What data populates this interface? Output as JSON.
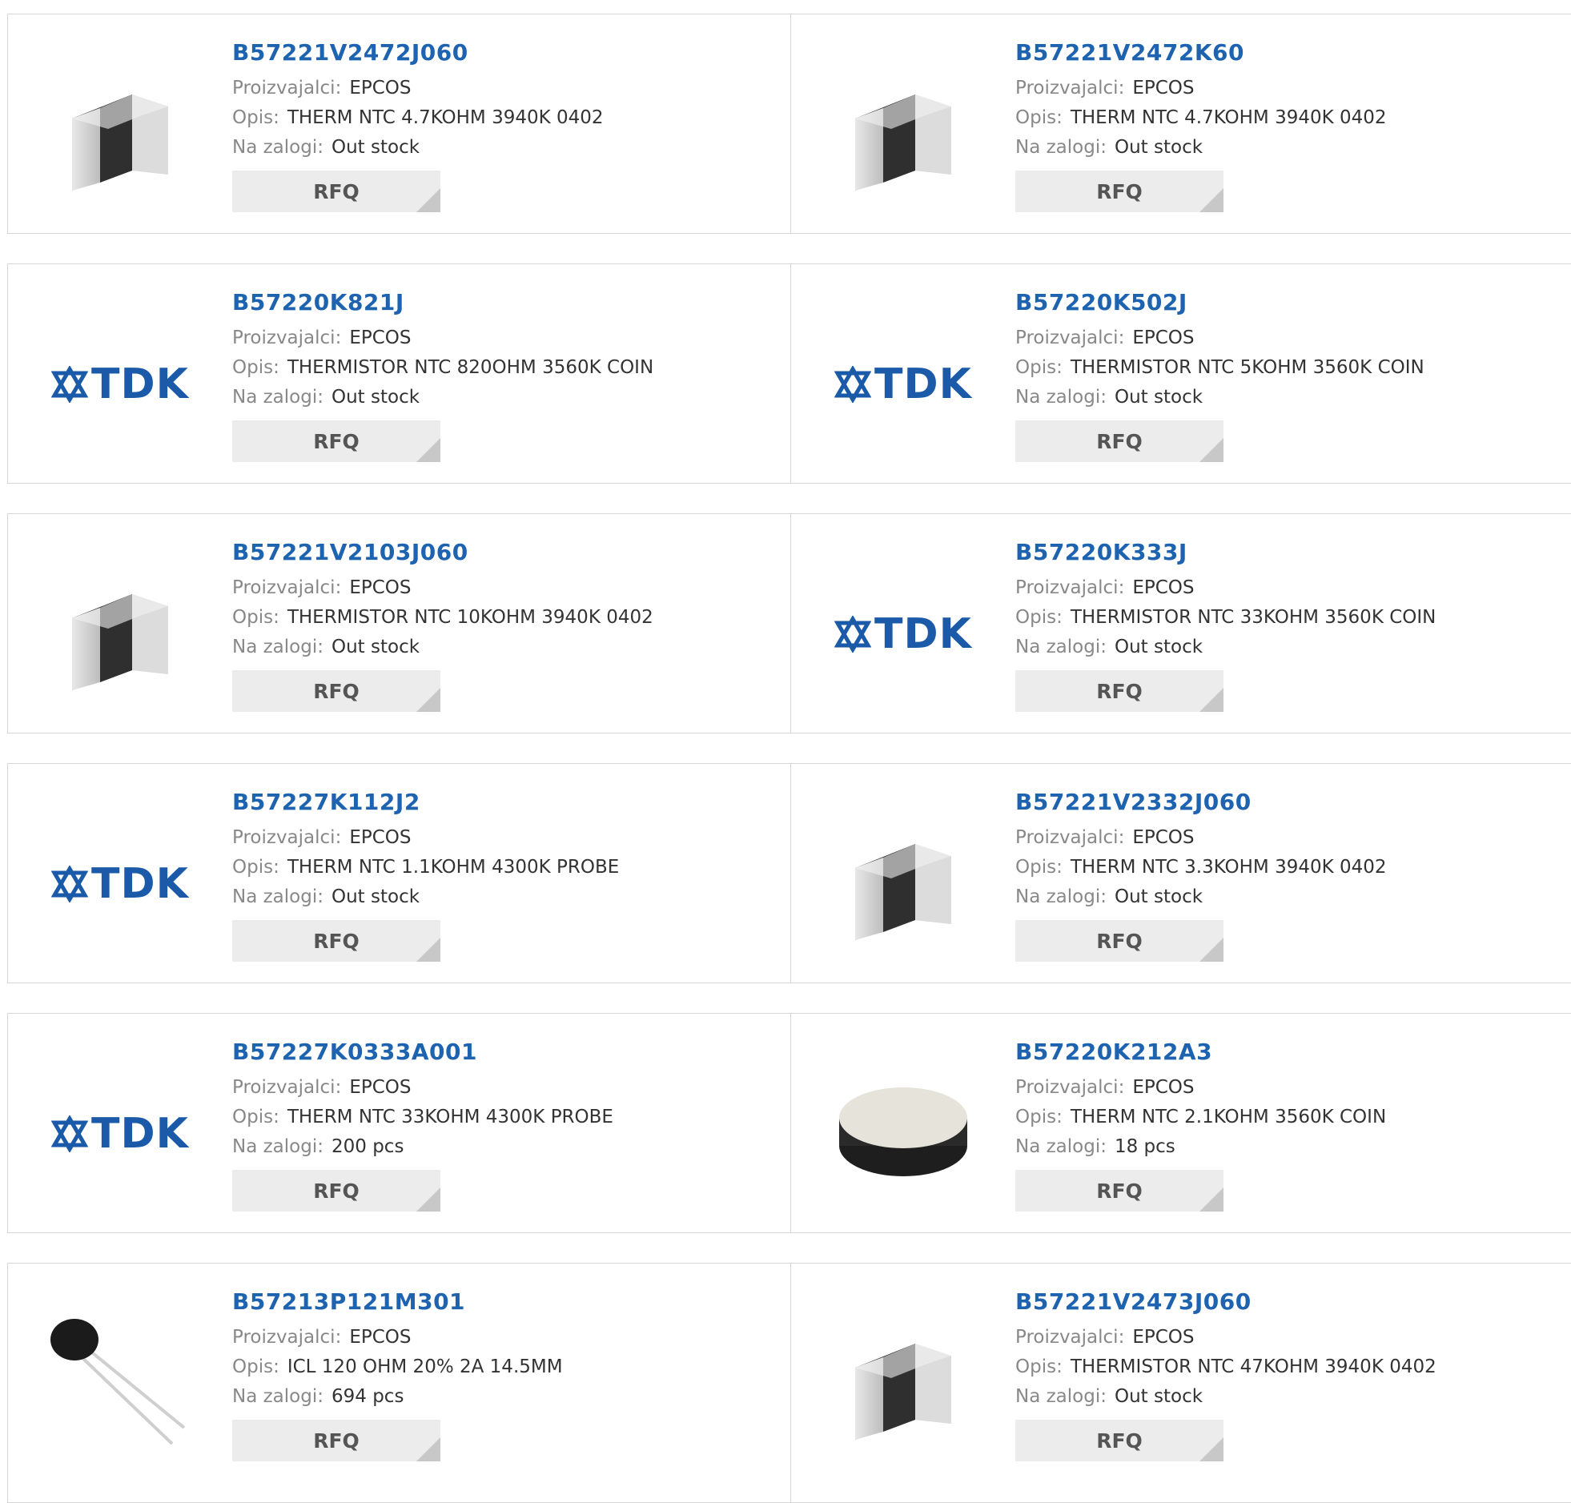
{
  "labels": {
    "manufacturer": "Proizvajalci:",
    "description": "Opis:",
    "stock": "Na zalogi:",
    "rfq": "RFQ"
  },
  "colors": {
    "link": "#1d63b0",
    "brand_tdk": "#1a5aa8",
    "rfq_bg": "#ececec"
  },
  "products": [
    {
      "pn": "B57221V2472J060",
      "manufacturer": "EPCOS",
      "description": "THERM NTC 4.7KOHM 3940K 0402",
      "stock": "Out stock",
      "image": "chip-0402"
    },
    {
      "pn": "B57221V2472K60",
      "manufacturer": "EPCOS",
      "description": "THERM NTC 4.7KOHM 3940K 0402",
      "stock": "Out stock",
      "image": "chip-0402"
    },
    {
      "pn": "B57220K821J",
      "manufacturer": "EPCOS",
      "description": "THERMISTOR NTC 820OHM 3560K COIN",
      "stock": "Out stock",
      "image": "tdk-logo"
    },
    {
      "pn": "B57220K502J",
      "manufacturer": "EPCOS",
      "description": "THERMISTOR NTC 5KOHM 3560K COIN",
      "stock": "Out stock",
      "image": "tdk-logo"
    },
    {
      "pn": "B57221V2103J060",
      "manufacturer": "EPCOS",
      "description": "THERMISTOR NTC 10KOHM 3940K 0402",
      "stock": "Out stock",
      "image": "chip-0402"
    },
    {
      "pn": "B57220K333J",
      "manufacturer": "EPCOS",
      "description": "THERMISTOR NTC 33KOHM 3560K COIN",
      "stock": "Out stock",
      "image": "tdk-logo"
    },
    {
      "pn": "B57227K112J2",
      "manufacturer": "EPCOS",
      "description": "THERM NTC 1.1KOHM 4300K PROBE",
      "stock": "Out stock",
      "image": "tdk-logo"
    },
    {
      "pn": "B57221V2332J060",
      "manufacturer": "EPCOS",
      "description": "THERM NTC 3.3KOHM 3940K 0402",
      "stock": "Out stock",
      "image": "chip-0402"
    },
    {
      "pn": "B57227K0333A001",
      "manufacturer": "EPCOS",
      "description": "THERM NTC 33KOHM 4300K PROBE",
      "stock": "200 pcs",
      "image": "tdk-logo"
    },
    {
      "pn": "B57220K212A3",
      "manufacturer": "EPCOS",
      "description": "THERM NTC 2.1KOHM 3560K COIN",
      "stock": "18 pcs",
      "image": "coin-disc"
    },
    {
      "pn": "B57213P121M301",
      "manufacturer": "EPCOS",
      "description": "ICL 120 OHM 20% 2A 14.5MM",
      "stock": "694 pcs",
      "image": "radial-thermistor"
    },
    {
      "pn": "B57221V2473J060",
      "manufacturer": "EPCOS",
      "description": "THERMISTOR NTC 47KOHM 3940K 0402",
      "stock": "Out stock",
      "image": "chip-0402"
    }
  ]
}
